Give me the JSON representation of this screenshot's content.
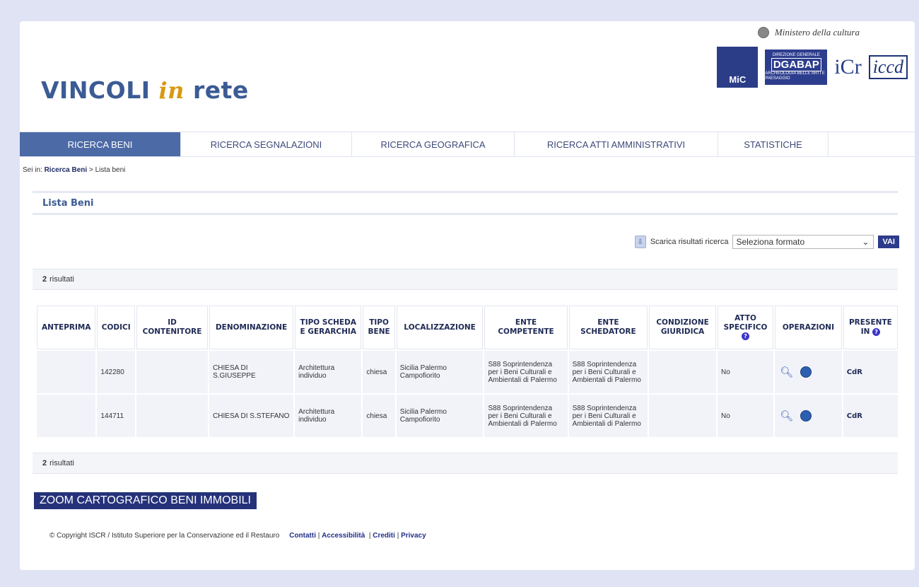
{
  "header": {
    "brand_main": "VINCOLI",
    "brand_in": "in",
    "brand_rete": "rete",
    "ministry": "Ministero della cultura",
    "logo_mic": "MiC",
    "logo_dgabap_small": "DIREZIONE GENERALE",
    "logo_dgabap_big": "DGABAP",
    "logo_dgabap_sub": "ARCHEOLOGIA BELLE ARTI E PAESAGGIO",
    "logo_icr": "iCr",
    "logo_iccd": "iccd"
  },
  "tabs": [
    {
      "label": "RICERCA BENI",
      "active": true
    },
    {
      "label": "RICERCA SEGNALAZIONI"
    },
    {
      "label": "RICERCA GEOGRAFICA"
    },
    {
      "label": "RICERCA ATTI AMMINISTRATIVI"
    },
    {
      "label": "STATISTICHE"
    }
  ],
  "breadcrumb": {
    "prefix": "Sei in:",
    "link": "Ricerca Beni",
    "sep": ">",
    "current": "Lista beni"
  },
  "section_title": "Lista Beni",
  "download": {
    "label": "Scarica risultati ricerca",
    "select_value": "Seleziona formato",
    "button": "VAI"
  },
  "results": {
    "count": "2",
    "label": "risultati"
  },
  "table": {
    "headers": [
      "ANTEPRIMA",
      "CODICI",
      "ID CONTENITORE",
      "DENOMINAZIONE",
      "TIPO SCHEDA E GERARCHIA",
      "TIPO BENE",
      "LOCALIZZAZIONE",
      "ENTE COMPETENTE",
      "ENTE SCHEDATORE",
      "CONDIZIONE GIURIDICA",
      "ATTO SPECIFICO",
      "OPERAZIONI",
      "PRESENTE IN"
    ],
    "rows": [
      {
        "anteprima": "",
        "codici": "142280",
        "id_contenitore": "",
        "denominazione": "CHIESA DI S.GIUSEPPE",
        "tipo_scheda": "Architettura individuo",
        "tipo_bene": "chiesa",
        "localizzazione": "Sicilia Palermo Campofiorito",
        "ente_competente": "S88 Soprintendenza per i Beni Culturali e Ambientali di Palermo",
        "ente_schedatore": "S88 Soprintendenza per i Beni Culturali e Ambientali di Palermo",
        "condizione": "",
        "atto": "No",
        "presente_in": "CdR"
      },
      {
        "anteprima": "",
        "codici": "144711",
        "id_contenitore": "",
        "denominazione": "CHIESA DI S.STEFANO",
        "tipo_scheda": "Architettura individuo",
        "tipo_bene": "chiesa",
        "localizzazione": "Sicilia Palermo Campofiorito",
        "ente_competente": "S88 Soprintendenza per i Beni Culturali e Ambientali di Palermo",
        "ente_schedatore": "S88 Soprintendenza per i Beni Culturali e Ambientali di Palermo",
        "condizione": "",
        "atto": "No",
        "presente_in": "CdR"
      }
    ]
  },
  "zoom_button": "ZOOM CARTOGRAFICO BENI IMMOBILI",
  "footer": {
    "copyright": "© Copyright ISCR / Istituto Superiore per la Conservazione ed il Restauro",
    "links": [
      "Contatti",
      "Accessibilità",
      "Crediti",
      "Privacy"
    ]
  },
  "colors": {
    "background": "#dfe3f3",
    "accent": "#4c6aa6",
    "dark_blue": "#25327a",
    "brand_in": "#d79a12"
  }
}
